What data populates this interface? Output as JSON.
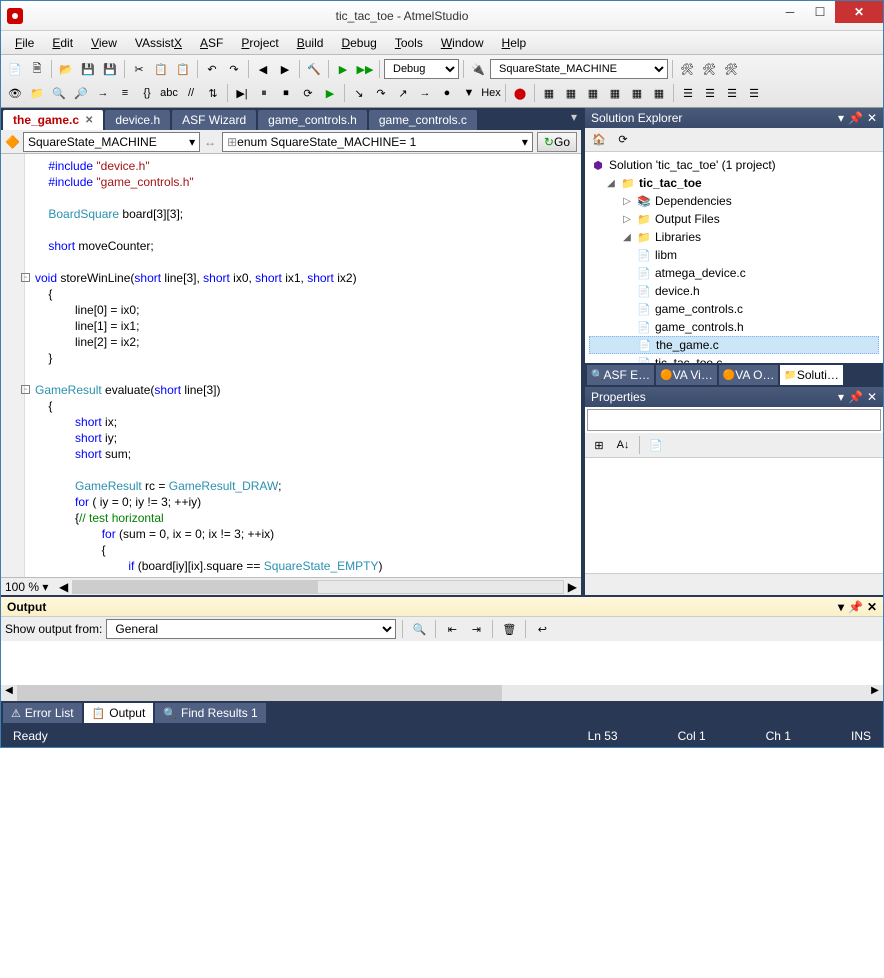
{
  "title": "tic_tac_toe - AtmelStudio",
  "menus": [
    "File",
    "Edit",
    "View",
    "VAssistX",
    "ASF",
    "Project",
    "Build",
    "Debug",
    "Tools",
    "Window",
    "Help"
  ],
  "config_combo": "Debug",
  "device_combo": "SquareState_MACHINE",
  "tabs": [
    {
      "label": "the_game.c",
      "active": true,
      "close": true
    },
    {
      "label": "device.h",
      "active": false,
      "close": false
    },
    {
      "label": "ASF Wizard",
      "active": false,
      "close": false
    },
    {
      "label": "game_controls.h",
      "active": false,
      "close": false
    },
    {
      "label": "game_controls.c",
      "active": false,
      "close": false
    }
  ],
  "nav_left": "SquareState_MACHINE",
  "nav_right": "enum SquareState_MACHINE= 1",
  "go": "Go",
  "zoom": "100 %",
  "code_lines": [
    {
      "indent": 1,
      "t": [
        {
          "k": "kw",
          "v": "#include "
        },
        {
          "k": "str",
          "v": "\"device.h\""
        }
      ]
    },
    {
      "indent": 1,
      "t": [
        {
          "k": "kw",
          "v": "#include "
        },
        {
          "k": "str",
          "v": "\"game_controls.h\""
        }
      ]
    },
    {
      "indent": 0,
      "t": []
    },
    {
      "indent": 1,
      "t": [
        {
          "k": "type",
          "v": "BoardSquare"
        },
        {
          "k": "",
          "v": " board["
        },
        {
          "k": "num",
          "v": "3"
        },
        {
          "k": "",
          "v": "]["
        },
        {
          "k": "num",
          "v": "3"
        },
        {
          "k": "",
          "v": "];"
        }
      ]
    },
    {
      "indent": 0,
      "t": []
    },
    {
      "indent": 1,
      "t": [
        {
          "k": "kw",
          "v": "short"
        },
        {
          "k": "",
          "v": " moveCounter;"
        }
      ]
    },
    {
      "indent": 0,
      "t": []
    },
    {
      "indent": 0,
      "fold": "-",
      "t": [
        {
          "k": "kw",
          "v": "void"
        },
        {
          "k": "",
          "v": " storeWinLine("
        },
        {
          "k": "kw",
          "v": "short"
        },
        {
          "k": "",
          "v": " line["
        },
        {
          "k": "num",
          "v": "3"
        },
        {
          "k": "",
          "v": "], "
        },
        {
          "k": "kw",
          "v": "short"
        },
        {
          "k": "",
          "v": " ix0, "
        },
        {
          "k": "kw",
          "v": "short"
        },
        {
          "k": "",
          "v": " ix1, "
        },
        {
          "k": "kw",
          "v": "short"
        },
        {
          "k": "",
          "v": " ix2)"
        }
      ]
    },
    {
      "indent": 1,
      "t": [
        {
          "k": "",
          "v": "{"
        }
      ]
    },
    {
      "indent": 3,
      "t": [
        {
          "k": "",
          "v": "line["
        },
        {
          "k": "num",
          "v": "0"
        },
        {
          "k": "",
          "v": "] = ix0;"
        }
      ]
    },
    {
      "indent": 3,
      "t": [
        {
          "k": "",
          "v": "line["
        },
        {
          "k": "num",
          "v": "1"
        },
        {
          "k": "",
          "v": "] = ix1;"
        }
      ]
    },
    {
      "indent": 3,
      "t": [
        {
          "k": "",
          "v": "line["
        },
        {
          "k": "num",
          "v": "2"
        },
        {
          "k": "",
          "v": "] = ix2;"
        }
      ]
    },
    {
      "indent": 1,
      "t": [
        {
          "k": "",
          "v": "}"
        }
      ]
    },
    {
      "indent": 0,
      "t": []
    },
    {
      "indent": 0,
      "fold": "-",
      "t": [
        {
          "k": "type",
          "v": "GameResult"
        },
        {
          "k": "",
          "v": " evaluate("
        },
        {
          "k": "kw",
          "v": "short"
        },
        {
          "k": "",
          "v": " line["
        },
        {
          "k": "num",
          "v": "3"
        },
        {
          "k": "",
          "v": "])"
        }
      ]
    },
    {
      "indent": 1,
      "t": [
        {
          "k": "",
          "v": "{"
        }
      ]
    },
    {
      "indent": 3,
      "t": [
        {
          "k": "kw",
          "v": "short"
        },
        {
          "k": "",
          "v": " ix;"
        }
      ]
    },
    {
      "indent": 3,
      "t": [
        {
          "k": "kw",
          "v": "short"
        },
        {
          "k": "",
          "v": " iy;"
        }
      ]
    },
    {
      "indent": 3,
      "t": [
        {
          "k": "kw",
          "v": "short"
        },
        {
          "k": "",
          "v": " sum;"
        }
      ]
    },
    {
      "indent": 0,
      "t": []
    },
    {
      "indent": 3,
      "t": [
        {
          "k": "type",
          "v": "GameResult"
        },
        {
          "k": "",
          "v": " rc = "
        },
        {
          "k": "type",
          "v": "GameResult_DRAW"
        },
        {
          "k": "",
          "v": ";"
        }
      ]
    },
    {
      "indent": 3,
      "t": [
        {
          "k": "kw",
          "v": "for"
        },
        {
          "k": "",
          "v": " ( iy = "
        },
        {
          "k": "num",
          "v": "0"
        },
        {
          "k": "",
          "v": "; iy != "
        },
        {
          "k": "num",
          "v": "3"
        },
        {
          "k": "",
          "v": "; ++iy)"
        }
      ]
    },
    {
      "indent": 3,
      "t": [
        {
          "k": "",
          "v": "{"
        },
        {
          "k": "cmt",
          "v": "// test horizontal"
        }
      ]
    },
    {
      "indent": 5,
      "t": [
        {
          "k": "kw",
          "v": "for"
        },
        {
          "k": "",
          "v": " (sum = "
        },
        {
          "k": "num",
          "v": "0"
        },
        {
          "k": "",
          "v": ", ix = "
        },
        {
          "k": "num",
          "v": "0"
        },
        {
          "k": "",
          "v": "; ix != "
        },
        {
          "k": "num",
          "v": "3"
        },
        {
          "k": "",
          "v": "; ++ix)"
        }
      ]
    },
    {
      "indent": 5,
      "t": [
        {
          "k": "",
          "v": "{"
        }
      ]
    },
    {
      "indent": 7,
      "t": [
        {
          "k": "kw",
          "v": "if"
        },
        {
          "k": "",
          "v": " (board[iy][ix].square == "
        },
        {
          "k": "type",
          "v": "SquareState_EMPTY"
        },
        {
          "k": "",
          "v": ")"
        }
      ]
    },
    {
      "indent": 7,
      "t": [
        {
          "k": "",
          "v": "{"
        }
      ]
    }
  ],
  "solution_explorer": {
    "title": "Solution Explorer",
    "root": "Solution 'tic_tac_toe' (1 project)",
    "project": "tic_tac_toe",
    "nodes": [
      "Dependencies",
      "Output Files",
      "Libraries"
    ],
    "lib": "libm",
    "files": [
      "atmega_device.c",
      "device.h",
      "game_controls.c",
      "game_controls.h",
      "the_game.c",
      "tic_tac_toe.c"
    ]
  },
  "right_tabs": [
    "ASF E…",
    "VA Vi…",
    "VA O…",
    "Soluti…"
  ],
  "properties": {
    "title": "Properties"
  },
  "output": {
    "title": "Output",
    "show_from_label": "Show output from:",
    "show_from_value": "General"
  },
  "bottom_tabs": [
    "Error List",
    "Output",
    "Find Results 1"
  ],
  "status": {
    "ready": "Ready",
    "ln": "Ln 53",
    "col": "Col 1",
    "ch": "Ch 1",
    "ins": "INS"
  }
}
